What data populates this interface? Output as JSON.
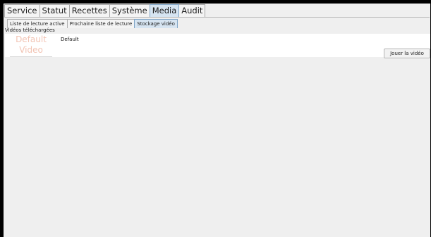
{
  "main_tabs": [
    {
      "label": "Service",
      "active": false
    },
    {
      "label": "Statut",
      "active": false
    },
    {
      "label": "Recettes",
      "active": false
    },
    {
      "label": "Système",
      "active": false
    },
    {
      "label": "Media",
      "active": true
    },
    {
      "label": "Audit",
      "active": false
    }
  ],
  "sub_tabs": [
    {
      "label": "Liste de lecture active",
      "active": false
    },
    {
      "label": "Prochaine liste de lecture",
      "active": false
    },
    {
      "label": "Stockage vidéo",
      "active": true
    }
  ],
  "section_label": "Vidéos téléchargées",
  "video": {
    "thumbnail_line1": "Default",
    "thumbnail_line2": "Video",
    "name": "Default"
  },
  "play_button_label": "Jouer la vidéo",
  "colors": {
    "active_tab_bg": "#d6e4f1",
    "thumbnail_text": "#f2c4b4",
    "window_bg": "#efefef",
    "panel_bg": "#ffffff"
  }
}
